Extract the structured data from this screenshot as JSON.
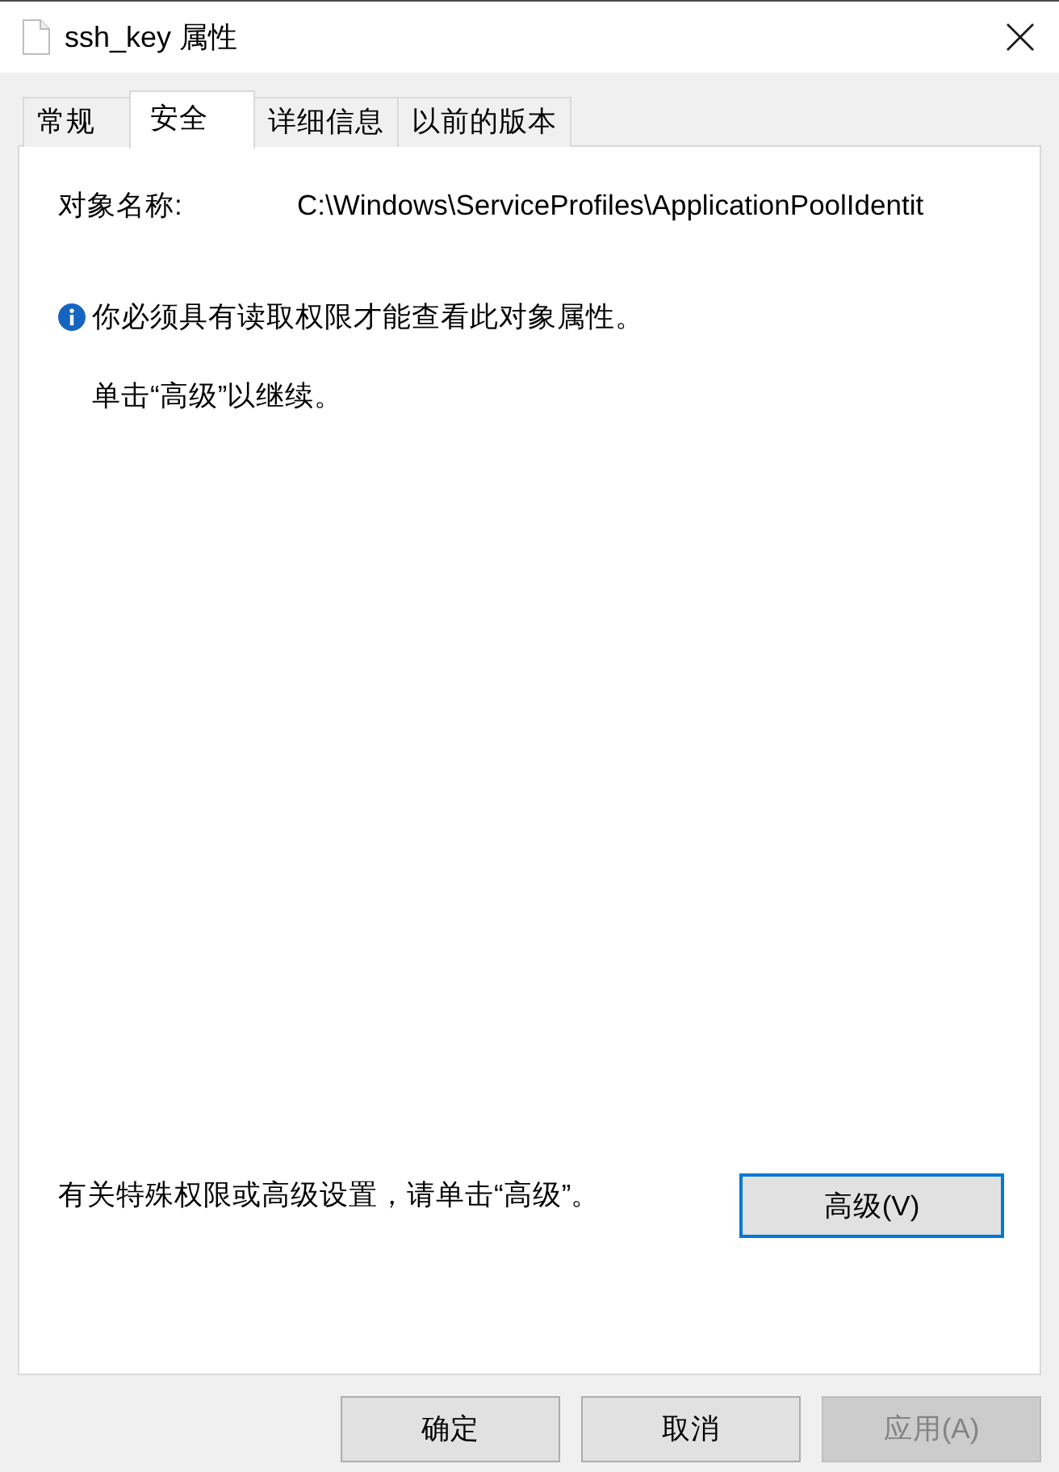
{
  "window": {
    "title": "ssh_key 属性"
  },
  "tabs": [
    {
      "label": "常规",
      "selected": false
    },
    {
      "label": "安全",
      "selected": true
    },
    {
      "label": "详细信息",
      "selected": false
    },
    {
      "label": "以前的版本",
      "selected": false
    }
  ],
  "object_name": {
    "label": "对象名称:",
    "value": "C:\\Windows\\ServiceProfiles\\ApplicationPoolIdentit"
  },
  "notice": {
    "message": "你必须具有读取权限才能查看此对象属性。",
    "hint": "单击“高级”以继续。"
  },
  "advanced": {
    "text": "有关特殊权限或高级设置，请单击“高级”。",
    "button": {
      "label": "高级(V)",
      "focused": true
    }
  },
  "buttons": [
    {
      "label": "确定",
      "disabled": false
    },
    {
      "label": "取消",
      "disabled": false
    },
    {
      "label": "应用(A)",
      "disabled": true
    }
  ]
}
